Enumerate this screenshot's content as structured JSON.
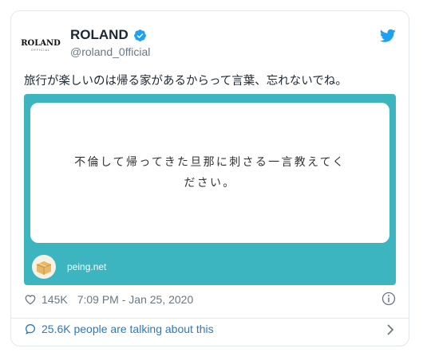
{
  "user": {
    "display_name": "ROLAND",
    "handle": "@roland_0fficial",
    "avatar_logo": "ROLAND",
    "avatar_sub": "OFFICIAL",
    "verified": true
  },
  "tweet": {
    "text": "旅行が楽しいのは帰る家があるからって言葉、忘れないでね。"
  },
  "media": {
    "question_line1": "不倫して帰ってきた旦那に刺さる一言教えてく",
    "question_line2": "ださい。",
    "site_label": "peing.net"
  },
  "meta": {
    "likes": "145K",
    "timestamp": "7:09 PM - Jan 25, 2020"
  },
  "footer": {
    "discussion": "25.6K people are talking about this"
  },
  "colors": {
    "twitter_blue": "#1da1f2",
    "media_teal": "#3db5c1",
    "link_blue": "#2b7bb9",
    "muted_gray": "#697882"
  },
  "icons": [
    "verified-icon",
    "twitter-bird-icon",
    "heart-icon",
    "info-icon",
    "speech-bubble-icon",
    "chevron-right-icon",
    "peing-box-icon"
  ]
}
